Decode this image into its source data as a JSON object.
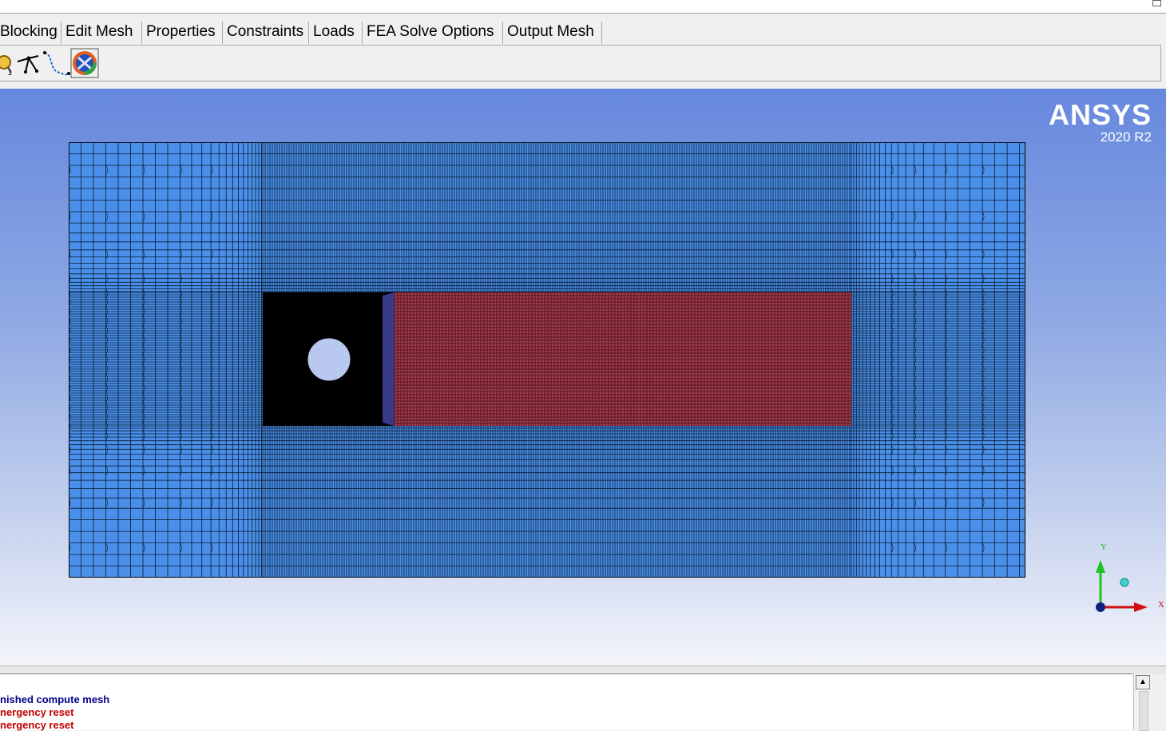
{
  "tabs": [
    "Blocking",
    "Edit Mesh",
    "Properties",
    "Constraints",
    "Loads",
    "FEA Solve Options",
    "Output Mesh"
  ],
  "toolbar": {
    "icons": [
      "magnify-icon",
      "create-block-icon",
      "curve-spline-icon",
      "block-display-icon"
    ]
  },
  "viewport": {
    "brand": "ANSYS",
    "version": "2020 R2",
    "axes": {
      "y": "Y",
      "x": "X"
    }
  },
  "colors": {
    "viewport_top": "#6688dd",
    "viewport_bottom": "#f4f5fb",
    "mesh_fill": "#4a90ea",
    "dense_region": "#000000",
    "red_region": "#a23a4a",
    "hole_fill": "#b8c8ee"
  },
  "messages": [
    {
      "text": "nished compute mesh",
      "color": "#00008b"
    },
    {
      "text": "nergency reset",
      "color": "#c00000"
    },
    {
      "text": "nergency reset",
      "color": "#c00000"
    }
  ]
}
